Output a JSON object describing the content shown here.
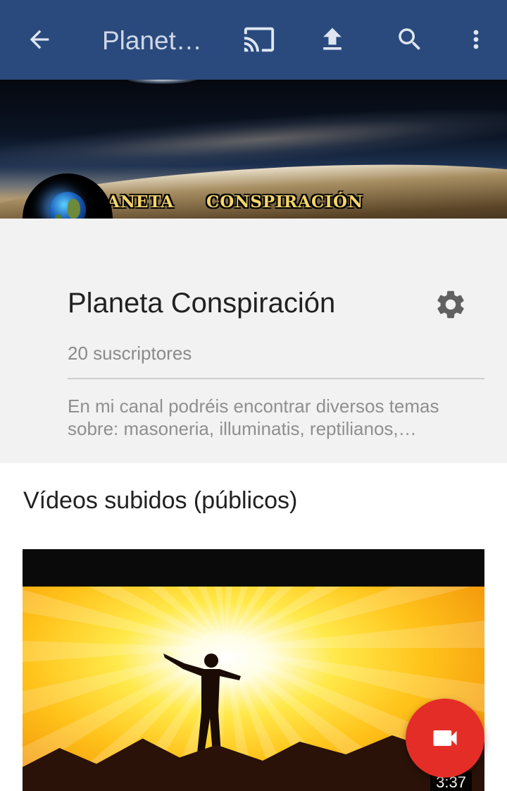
{
  "appbar": {
    "title": "Planet…",
    "icons": [
      "arrow-left-icon",
      "cast-icon",
      "upload-icon",
      "search-icon",
      "more-vert-icon"
    ],
    "color": "#2a4a7e"
  },
  "banner": {
    "left_text": "ANETA",
    "right_text": "CONSPIRACIÓN"
  },
  "channel": {
    "name": "Planeta Conspiración",
    "subscribers": "20 suscriptores",
    "description": "En mi canal podréis encontrar diversos temas sobre: masoneria, illuminatis, reptilianos,…"
  },
  "section": {
    "title": "Vídeos subidos (públicos)"
  },
  "video": {
    "duration": "3:37"
  },
  "fab": {
    "icon": "videocam-icon",
    "color": "#e52d27"
  }
}
